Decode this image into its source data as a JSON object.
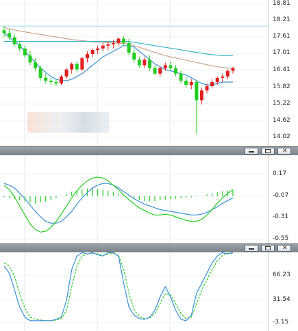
{
  "main_pane": {
    "price_labels": [
      "18.81",
      "18.21",
      "17.61",
      "17.01",
      "16.41",
      "15.82",
      "15.22",
      "14.62",
      "14.02"
    ],
    "colors": {
      "up": "#e02020",
      "down": "#22cc22",
      "ma_fast": "#3a8fd6",
      "ma_slow": "#c9a48a",
      "ma_mid": "#38b6c8"
    },
    "candles": [
      [
        17.85,
        18.0,
        17.6,
        17.75
      ],
      [
        17.75,
        17.9,
        17.5,
        17.6
      ],
      [
        17.6,
        17.7,
        17.3,
        17.35
      ],
      [
        17.35,
        17.45,
        17.1,
        17.2
      ],
      [
        17.2,
        17.3,
        16.85,
        16.95
      ],
      [
        16.95,
        17.1,
        16.6,
        16.7
      ],
      [
        16.7,
        16.85,
        16.4,
        16.5
      ],
      [
        16.5,
        16.6,
        16.05,
        16.15
      ],
      [
        16.15,
        16.3,
        15.95,
        16.05
      ],
      [
        16.05,
        16.15,
        15.9,
        16.0
      ],
      [
        16.0,
        16.1,
        15.85,
        15.95
      ],
      [
        15.95,
        16.25,
        15.9,
        16.2
      ],
      [
        16.2,
        16.5,
        16.1,
        16.45
      ],
      [
        16.45,
        16.7,
        16.3,
        16.65
      ],
      [
        16.65,
        16.75,
        16.35,
        16.45
      ],
      [
        16.45,
        16.9,
        16.4,
        16.85
      ],
      [
        16.85,
        17.1,
        16.7,
        17.0
      ],
      [
        17.0,
        17.2,
        16.9,
        17.15
      ],
      [
        17.15,
        17.3,
        17.0,
        17.2
      ],
      [
        17.2,
        17.4,
        17.1,
        17.3
      ],
      [
        17.3,
        17.45,
        17.15,
        17.35
      ],
      [
        17.35,
        17.5,
        17.2,
        17.4
      ],
      [
        17.4,
        17.6,
        17.3,
        17.55
      ],
      [
        17.55,
        17.65,
        17.3,
        17.4
      ],
      [
        17.4,
        17.55,
        16.95,
        17.05
      ],
      [
        17.05,
        17.2,
        16.7,
        16.8
      ],
      [
        16.8,
        16.9,
        16.5,
        16.6
      ],
      [
        16.6,
        16.9,
        16.5,
        16.8
      ],
      [
        16.8,
        16.95,
        16.4,
        16.5
      ],
      [
        16.5,
        16.6,
        16.25,
        16.3
      ],
      [
        16.3,
        16.55,
        16.2,
        16.5
      ],
      [
        16.5,
        16.7,
        16.4,
        16.6
      ],
      [
        16.6,
        16.75,
        16.4,
        16.5
      ],
      [
        16.5,
        16.6,
        16.2,
        16.3
      ],
      [
        16.3,
        16.4,
        15.95,
        16.05
      ],
      [
        16.05,
        16.2,
        15.8,
        15.9
      ],
      [
        15.9,
        16.1,
        15.75,
        16.0
      ],
      [
        16.0,
        16.05,
        14.15,
        15.35
      ],
      [
        15.35,
        15.8,
        15.2,
        15.7
      ],
      [
        15.7,
        15.95,
        15.6,
        15.85
      ],
      [
        15.85,
        16.1,
        15.8,
        16.0
      ],
      [
        16.0,
        16.2,
        15.9,
        16.15
      ],
      [
        16.15,
        16.3,
        16.0,
        16.2
      ],
      [
        16.2,
        16.45,
        16.1,
        16.4
      ],
      [
        16.4,
        16.55,
        16.3,
        16.5
      ]
    ],
    "ma_fast": [
      17.75,
      17.6,
      17.45,
      17.3,
      17.1,
      16.9,
      16.7,
      16.5,
      16.35,
      16.2,
      16.1,
      16.05,
      16.05,
      16.1,
      16.2,
      16.3,
      16.45,
      16.6,
      16.75,
      16.9,
      17.0,
      17.1,
      17.2,
      17.3,
      17.3,
      17.25,
      17.1,
      16.95,
      16.8,
      16.65,
      16.55,
      16.45,
      16.4,
      16.35,
      16.3,
      16.25,
      16.15,
      16.05,
      15.95,
      15.9,
      15.9,
      15.95,
      16.0,
      16.0,
      16.0
    ],
    "ma_mid": [
      17.45,
      17.45,
      17.45,
      17.45,
      17.45,
      17.45,
      17.45,
      17.45,
      17.45,
      17.45,
      17.45,
      17.45,
      17.45,
      17.45,
      17.45,
      17.45,
      17.45,
      17.45,
      17.45,
      17.45,
      17.45,
      17.45,
      17.45,
      17.45,
      17.45,
      17.42,
      17.39,
      17.36,
      17.33,
      17.3,
      17.27,
      17.24,
      17.21,
      17.18,
      17.15,
      17.12,
      17.09,
      17.06,
      17.03,
      17.0,
      16.98,
      16.96,
      16.95,
      16.95,
      16.95
    ],
    "ma_slow": [
      17.95,
      17.9,
      17.86,
      17.82,
      17.79,
      17.76,
      17.73,
      17.7,
      17.67,
      17.64,
      17.61,
      17.58,
      17.55,
      17.52,
      17.5,
      17.48,
      17.46,
      17.44,
      17.43,
      17.42,
      17.41,
      17.4,
      17.39,
      17.38,
      17.35,
      17.3,
      17.24,
      17.18,
      17.12,
      17.06,
      17.0,
      16.95,
      16.9,
      16.86,
      16.82,
      16.78,
      16.74,
      16.7,
      16.66,
      16.62,
      16.58,
      16.55,
      16.52,
      16.5,
      16.48
    ]
  },
  "macd_pane": {
    "labels": [
      "0.17",
      "-0.07",
      "-0.31",
      "-0.55"
    ],
    "colors": {
      "hist": "#22cc22",
      "signal": "#3a8fd6",
      "macd": "#22cc22"
    },
    "hist": [
      -0.02,
      -0.03,
      -0.05,
      -0.08,
      -0.1,
      -0.12,
      -0.14,
      -0.12,
      -0.1,
      -0.08,
      -0.04,
      0.0,
      0.04,
      0.08,
      0.1,
      0.12,
      0.14,
      0.14,
      0.13,
      0.12,
      0.1,
      0.08,
      0.05,
      0.02,
      -0.01,
      -0.04,
      -0.07,
      -0.09,
      -0.1,
      -0.1,
      -0.08,
      -0.06,
      -0.06,
      -0.05,
      -0.04,
      -0.03,
      -0.02,
      -0.01,
      0.0,
      0.03,
      0.05,
      0.07,
      0.09,
      0.1,
      0.11
    ],
    "macd": [
      0.05,
      0.0,
      -0.08,
      -0.18,
      -0.28,
      -0.38,
      -0.44,
      -0.47,
      -0.46,
      -0.42,
      -0.35,
      -0.27,
      -0.18,
      -0.09,
      -0.01,
      0.05,
      0.1,
      0.13,
      0.14,
      0.13,
      0.1,
      0.05,
      0.0,
      -0.06,
      -0.11,
      -0.16,
      -0.2,
      -0.23,
      -0.26,
      -0.28,
      -0.28,
      -0.27,
      -0.28,
      -0.3,
      -0.32,
      -0.34,
      -0.35,
      -0.35,
      -0.33,
      -0.28,
      -0.22,
      -0.15,
      -0.09,
      -0.04,
      0.0
    ],
    "signal": [
      0.07,
      0.05,
      0.02,
      -0.04,
      -0.1,
      -0.17,
      -0.24,
      -0.3,
      -0.35,
      -0.37,
      -0.37,
      -0.35,
      -0.3,
      -0.24,
      -0.16,
      -0.09,
      -0.03,
      0.02,
      0.05,
      0.07,
      0.07,
      0.05,
      0.02,
      -0.02,
      -0.06,
      -0.1,
      -0.13,
      -0.16,
      -0.18,
      -0.2,
      -0.22,
      -0.23,
      -0.24,
      -0.25,
      -0.26,
      -0.27,
      -0.28,
      -0.28,
      -0.27,
      -0.25,
      -0.22,
      -0.19,
      -0.15,
      -0.12,
      -0.09
    ]
  },
  "stoch_pane": {
    "labels": [
      "66.23",
      "31.54",
      "-3.15"
    ],
    "colors": {
      "k": "#3a8fd6",
      "d": "#22cc22"
    },
    "k": [
      80,
      70,
      45,
      20,
      5,
      0,
      0,
      0,
      0,
      0,
      2,
      5,
      30,
      75,
      95,
      100,
      98,
      100,
      97,
      95,
      100,
      100,
      95,
      55,
      20,
      8,
      3,
      2,
      5,
      15,
      35,
      50,
      35,
      15,
      2,
      0,
      8,
      40,
      55,
      70,
      85,
      95,
      100,
      98,
      100
    ],
    "d": [
      85,
      80,
      65,
      40,
      18,
      5,
      2,
      1,
      0,
      0,
      1,
      3,
      15,
      50,
      80,
      95,
      98,
      99,
      98,
      96,
      98,
      99,
      96,
      75,
      40,
      16,
      6,
      3,
      4,
      10,
      25,
      40,
      38,
      25,
      10,
      3,
      5,
      25,
      45,
      60,
      75,
      88,
      96,
      99,
      99
    ]
  },
  "window_controls": {
    "minimize": "_",
    "maximize": "□",
    "close": "✕"
  }
}
